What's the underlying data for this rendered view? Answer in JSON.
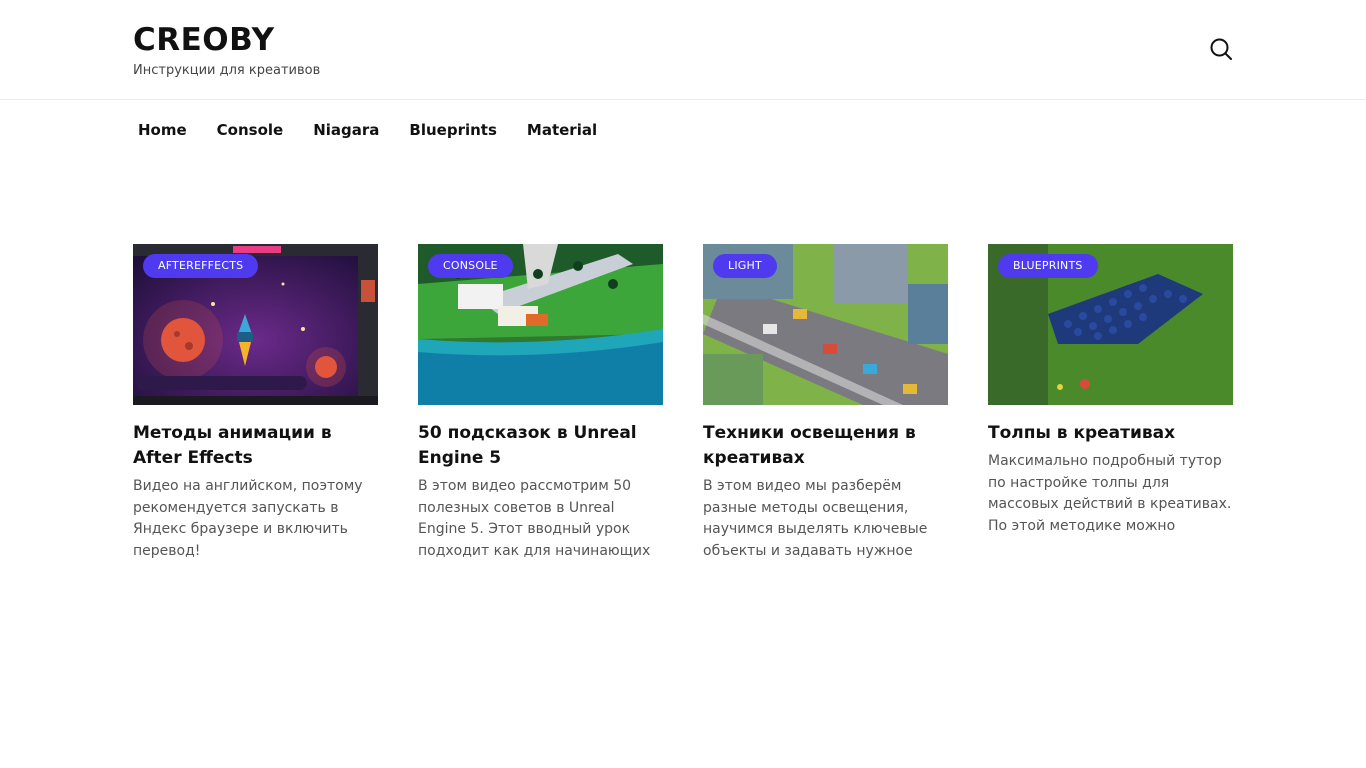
{
  "header": {
    "logo": "CREOBY",
    "tagline": "Инструкции для креативов",
    "search_icon": "search-icon"
  },
  "nav": [
    {
      "label": "Home"
    },
    {
      "label": "Console"
    },
    {
      "label": "Niagara"
    },
    {
      "label": "Blueprints"
    },
    {
      "label": "Material"
    }
  ],
  "accent_color": "#4f3af0",
  "cards": [
    {
      "tag": "AFTEREFFECTS",
      "title": "Методы анимации в After Effects",
      "excerpt": "Видео на английском, поэтому рекомендуется запускать в Яндекс браузере и включить перевод!"
    },
    {
      "tag": "CONSOLE",
      "title": "50 подсказок в Unreal Engine 5",
      "excerpt": "В этом видео рассмотрим 50 полезных советов в Unreal Engine 5. Этот вводный урок подходит как для начинающих"
    },
    {
      "tag": "LIGHT",
      "title": "Техники освещения в креативах",
      "excerpt": "В этом видео мы разберём разные методы освещения, научимся выделять ключевые объекты и задавать нужное"
    },
    {
      "tag": "BLUEPRINTS",
      "title": "Толпы в креативах",
      "excerpt": "Максимально подробный тутор по настройке толпы для массовых действий в креативах. По этой методике можно"
    }
  ]
}
